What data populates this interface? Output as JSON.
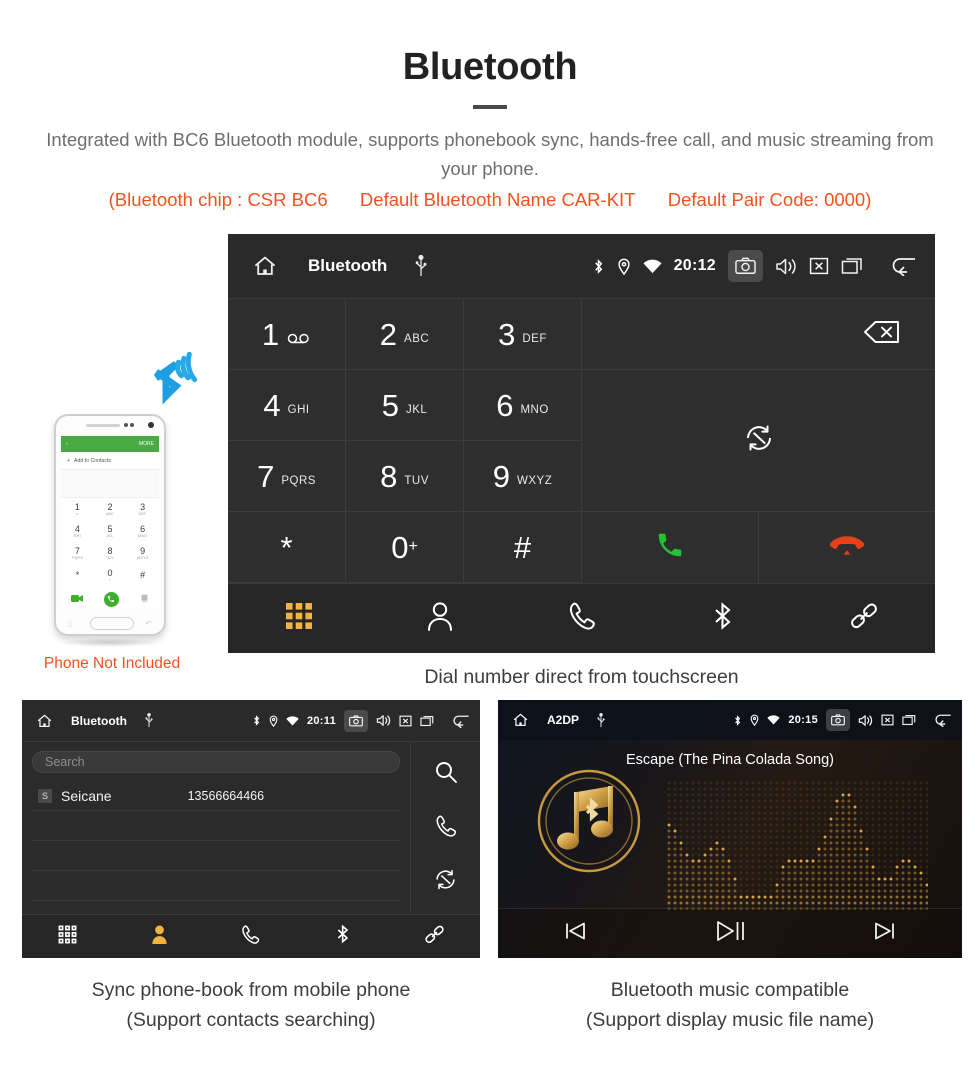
{
  "header": {
    "title": "Bluetooth",
    "description": "Integrated with BC6 Bluetooth module, supports phonebook sync, hands-free call, and music streaming from your phone.",
    "spec_chip": "(Bluetooth chip : CSR BC6",
    "spec_name": "Default Bluetooth Name CAR-KIT",
    "spec_pair": "Default Pair Code: 0000)",
    "accent_color": "#f4511e",
    "text_color": "#6e6e6e"
  },
  "dialer": {
    "statusbar": {
      "home_icon": "home-icon",
      "title": "Bluetooth",
      "usb_icon": "usb-icon",
      "bluetooth_icon": "bluetooth-icon",
      "location_icon": "location-icon",
      "wifi_icon": "wifi-icon",
      "time": "20:12",
      "camera_icon": "camera-icon",
      "volume_icon": "volume-icon",
      "close_icon": "close-box-icon",
      "recents_icon": "recents-icon",
      "back_icon": "back-arrow-icon"
    },
    "keys": [
      {
        "num": "1",
        "sub": "",
        "icon": "voicemail-icon"
      },
      {
        "num": "2",
        "sub": "ABC",
        "icon": ""
      },
      {
        "num": "3",
        "sub": "DEF",
        "icon": ""
      },
      {
        "num": "4",
        "sub": "GHI",
        "icon": ""
      },
      {
        "num": "5",
        "sub": "JKL",
        "icon": ""
      },
      {
        "num": "6",
        "sub": "MNO",
        "icon": ""
      },
      {
        "num": "7",
        "sub": "PQRS",
        "icon": ""
      },
      {
        "num": "8",
        "sub": "TUV",
        "icon": ""
      },
      {
        "num": "9",
        "sub": "WXYZ",
        "icon": ""
      },
      {
        "num": "*",
        "sub": "",
        "icon": ""
      },
      {
        "num": "0",
        "sub": "+",
        "icon": ""
      },
      {
        "num": "#",
        "sub": "",
        "icon": ""
      }
    ],
    "actions": {
      "backspace_icon": "backspace-icon",
      "sync_icon": "sync-icon",
      "call_icon": "call-icon",
      "call_color": "#22c234",
      "hangup_icon": "hangup-icon",
      "hangup_color": "#e8411a"
    },
    "nav": [
      {
        "name": "keypad",
        "icon": "keypad-grid-icon",
        "active": true
      },
      {
        "name": "contacts",
        "icon": "person-icon",
        "active": false
      },
      {
        "name": "call-log",
        "icon": "phone-handset-icon",
        "active": false
      },
      {
        "name": "bluetooth",
        "icon": "bluetooth-icon",
        "active": false
      },
      {
        "name": "pair",
        "icon": "link-chain-icon",
        "active": false
      }
    ],
    "active_color": "#f2b440",
    "caption": "Dial number direct from touchscreen"
  },
  "phone_art": {
    "bluetooth_signal_icon": "bluetooth-signal-icon",
    "signal_color": "#1e9fe3",
    "screen": {
      "back_icon": "back-arrow-icon",
      "more_label": "MORE",
      "add_contact_label": "Add to Contacts",
      "keys": [
        {
          "num": "1",
          "sub": "∞"
        },
        {
          "num": "2",
          "sub": "ABC"
        },
        {
          "num": "3",
          "sub": "DEF"
        },
        {
          "num": "4",
          "sub": "GHI"
        },
        {
          "num": "5",
          "sub": "JKL"
        },
        {
          "num": "6",
          "sub": "MNO"
        },
        {
          "num": "7",
          "sub": "PQRS"
        },
        {
          "num": "8",
          "sub": "TUV"
        },
        {
          "num": "9",
          "sub": "WXYZ"
        },
        {
          "num": "*",
          "sub": ""
        },
        {
          "num": "0",
          "sub": "+"
        },
        {
          "num": "#",
          "sub": ""
        }
      ],
      "video_call_icon": "video-call-icon",
      "call_icon": "call-icon",
      "backspace_icon": "backspace-icon"
    },
    "disclaimer": "Phone Not Included"
  },
  "phonebook": {
    "statusbar": {
      "title": "Bluetooth",
      "time": "20:11"
    },
    "search_placeholder": "Search",
    "contacts": [
      {
        "badge": "S",
        "name": "Seicane",
        "number": "13566664466"
      }
    ],
    "empty_rows": 3,
    "side_actions": [
      {
        "name": "search",
        "icon": "search-icon"
      },
      {
        "name": "call",
        "icon": "phone-handset-icon"
      },
      {
        "name": "sync",
        "icon": "sync-icon"
      }
    ],
    "nav": [
      {
        "name": "keypad",
        "icon": "keypad-grid-icon",
        "active": false
      },
      {
        "name": "contacts",
        "icon": "person-icon",
        "active": true
      },
      {
        "name": "call-log",
        "icon": "phone-handset-icon",
        "active": false
      },
      {
        "name": "bluetooth",
        "icon": "bluetooth-icon",
        "active": false
      },
      {
        "name": "pair",
        "icon": "link-chain-icon",
        "active": false
      }
    ],
    "caption_line1": "Sync phone-book from mobile phone",
    "caption_line2": "(Support contacts searching)"
  },
  "music": {
    "statusbar": {
      "title": "A2DP",
      "time": "20:15"
    },
    "song_title": "Escape (The Pina Colada Song)",
    "album_icon": "music-note-bluetooth-icon",
    "album_color": "#c99a3d",
    "visualizer": {
      "type": "dot-matrix-spectrum",
      "dot_color": "#e0a43a"
    },
    "controls": [
      {
        "name": "previous",
        "icon": "skip-previous-icon"
      },
      {
        "name": "play-pause",
        "icon": "play-pause-icon"
      },
      {
        "name": "next",
        "icon": "skip-next-icon"
      }
    ],
    "caption_line1": "Bluetooth music compatible",
    "caption_line2": "(Support display music file name)"
  }
}
